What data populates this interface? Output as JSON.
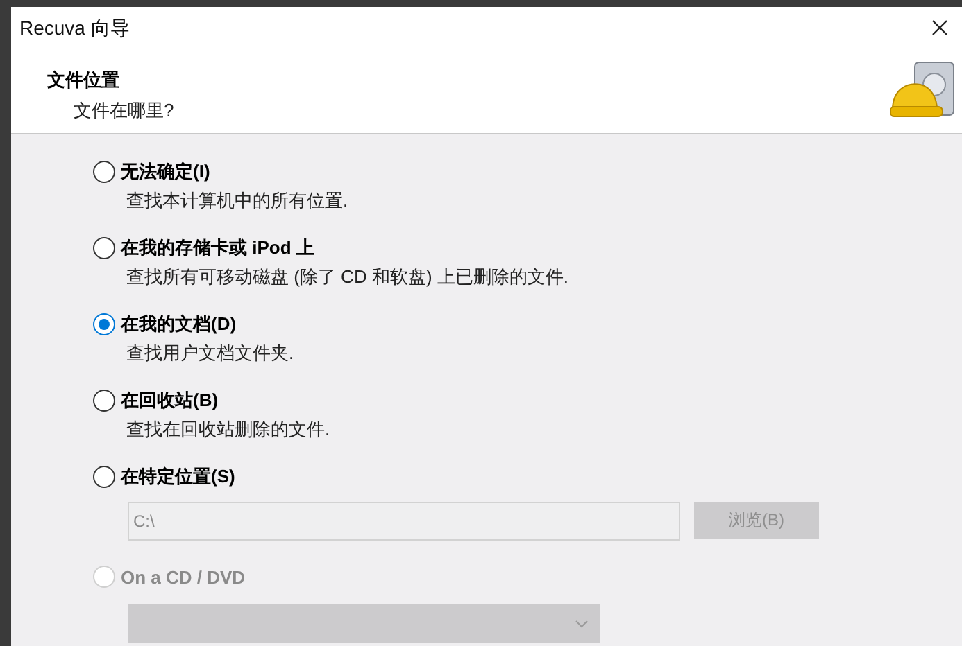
{
  "window": {
    "title": "Recuva 向导"
  },
  "header": {
    "title": "文件位置",
    "subtitle": "文件在哪里?"
  },
  "options": [
    {
      "label": "无法确定(I)",
      "description": "查找本计算机中的所有位置.",
      "selected": false,
      "disabled": false
    },
    {
      "label": "在我的存储卡或 iPod 上",
      "description": "查找所有可移动磁盘 (除了 CD 和软盘) 上已删除的文件.",
      "selected": false,
      "disabled": false
    },
    {
      "label": "在我的文档(D)",
      "description": "查找用户文档文件夹.",
      "selected": true,
      "disabled": false
    },
    {
      "label": "在回收站(B)",
      "description": "查找在回收站删除的文件.",
      "selected": false,
      "disabled": false
    },
    {
      "label": "在特定位置(S)",
      "selected": false,
      "disabled": false,
      "kind": "path"
    },
    {
      "label": "On a CD / DVD",
      "selected": false,
      "disabled": true,
      "kind": "drive"
    }
  ],
  "location": {
    "value": "C:\\",
    "disabled": true,
    "browse_button": {
      "label": "浏览(B)",
      "disabled": true
    }
  },
  "drive_select": {
    "disabled": true
  }
}
